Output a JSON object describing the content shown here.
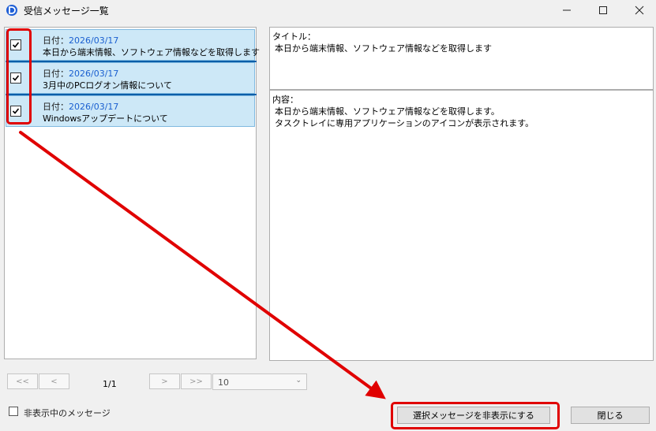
{
  "window": {
    "title": "受信メッセージ一覧",
    "app_icon": "app-d-icon",
    "controls": [
      "minimize-icon",
      "maximize-icon",
      "close-icon"
    ]
  },
  "messages": [
    {
      "date_label": "日付：",
      "date": "2026/03/17",
      "title": "本日から端末情報、ソフトウェア情報などを取得します",
      "checked": true
    },
    {
      "date_label": "日付：",
      "date": "2026/03/17",
      "title": "3月中のPCログオン情報について",
      "checked": true
    },
    {
      "date_label": "日付：",
      "date": "2026/03/17",
      "title": "Windowsアップデートについて",
      "checked": true
    }
  ],
  "detail": {
    "title_label": "タイトル：",
    "title_value": "本日から端末情報、ソフトウェア情報などを取得します",
    "content_label": "内容：",
    "content_value": "本日から端末情報、ソフトウェア情報などを取得します。\nタスクトレイに専用アプリケーションのアイコンが表示されます。"
  },
  "pager": {
    "first": "<<",
    "prev": "<",
    "info": "1/1",
    "next": ">",
    "last": ">>",
    "page_size": "10"
  },
  "footer": {
    "show_hidden_label": "非表示中のメッセージ",
    "show_hidden_checked": false,
    "hide_selected_button": "選択メッセージを非表示にする",
    "close_button": "閉じる"
  },
  "annotation": {
    "highlight_color": "#e00000"
  }
}
